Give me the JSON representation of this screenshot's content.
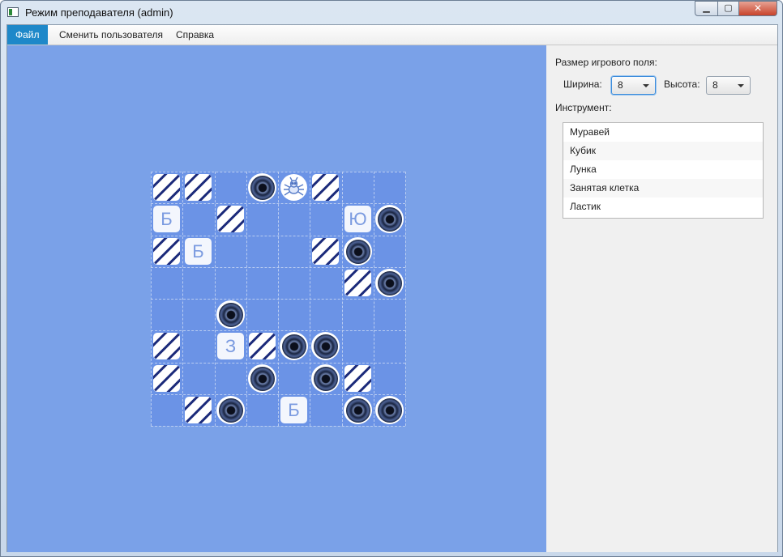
{
  "window": {
    "title": "Режим преподавателя (admin)",
    "min_glyph": "▁",
    "max_glyph": "▢",
    "close_glyph": "✕"
  },
  "menu": {
    "items": [
      "Файл",
      "Сменить пользователя",
      "Справка"
    ],
    "active_index": 0
  },
  "panel": {
    "size_heading": "Размер игрового поля:",
    "width_label": "Ширина:",
    "width_value": "8",
    "height_label": "Высота:",
    "height_value": "8",
    "tool_heading": "Инструмент:",
    "tools": [
      "Муравей",
      "Кубик",
      "Лунка",
      "Занятая клетка",
      "Ластик"
    ]
  },
  "board": {
    "cols": 8,
    "rows": 8,
    "cells": [
      {
        "row": 0,
        "col": 0,
        "type": "cube"
      },
      {
        "row": 0,
        "col": 1,
        "type": "cube"
      },
      {
        "row": 0,
        "col": 3,
        "type": "hole"
      },
      {
        "row": 0,
        "col": 4,
        "type": "ant"
      },
      {
        "row": 0,
        "col": 5,
        "type": "cube"
      },
      {
        "row": 1,
        "col": 0,
        "type": "letter",
        "label": "Б"
      },
      {
        "row": 1,
        "col": 2,
        "type": "cube"
      },
      {
        "row": 1,
        "col": 6,
        "type": "letter",
        "label": "Ю"
      },
      {
        "row": 1,
        "col": 7,
        "type": "hole"
      },
      {
        "row": 2,
        "col": 0,
        "type": "cube"
      },
      {
        "row": 2,
        "col": 1,
        "type": "letter",
        "label": "Б"
      },
      {
        "row": 2,
        "col": 5,
        "type": "cube"
      },
      {
        "row": 2,
        "col": 6,
        "type": "hole"
      },
      {
        "row": 3,
        "col": 6,
        "type": "cube"
      },
      {
        "row": 3,
        "col": 7,
        "type": "hole"
      },
      {
        "row": 4,
        "col": 2,
        "type": "hole"
      },
      {
        "row": 5,
        "col": 0,
        "type": "cube"
      },
      {
        "row": 5,
        "col": 2,
        "type": "letter",
        "label": "З"
      },
      {
        "row": 5,
        "col": 3,
        "type": "cube"
      },
      {
        "row": 5,
        "col": 4,
        "type": "hole"
      },
      {
        "row": 5,
        "col": 5,
        "type": "hole"
      },
      {
        "row": 6,
        "col": 0,
        "type": "cube"
      },
      {
        "row": 6,
        "col": 3,
        "type": "hole"
      },
      {
        "row": 6,
        "col": 5,
        "type": "hole"
      },
      {
        "row": 6,
        "col": 6,
        "type": "cube"
      },
      {
        "row": 7,
        "col": 1,
        "type": "cube"
      },
      {
        "row": 7,
        "col": 2,
        "type": "hole"
      },
      {
        "row": 7,
        "col": 4,
        "type": "letter",
        "label": "Б"
      },
      {
        "row": 7,
        "col": 6,
        "type": "hole"
      },
      {
        "row": 7,
        "col": 7,
        "type": "hole"
      }
    ]
  },
  "colors": {
    "board_bg": "#7aa1e8",
    "grid_bg": "#6b93e6",
    "cube_stripe": "#1c2e80",
    "menu_active": "#1e88c9",
    "focus": "#3d8ddc"
  }
}
